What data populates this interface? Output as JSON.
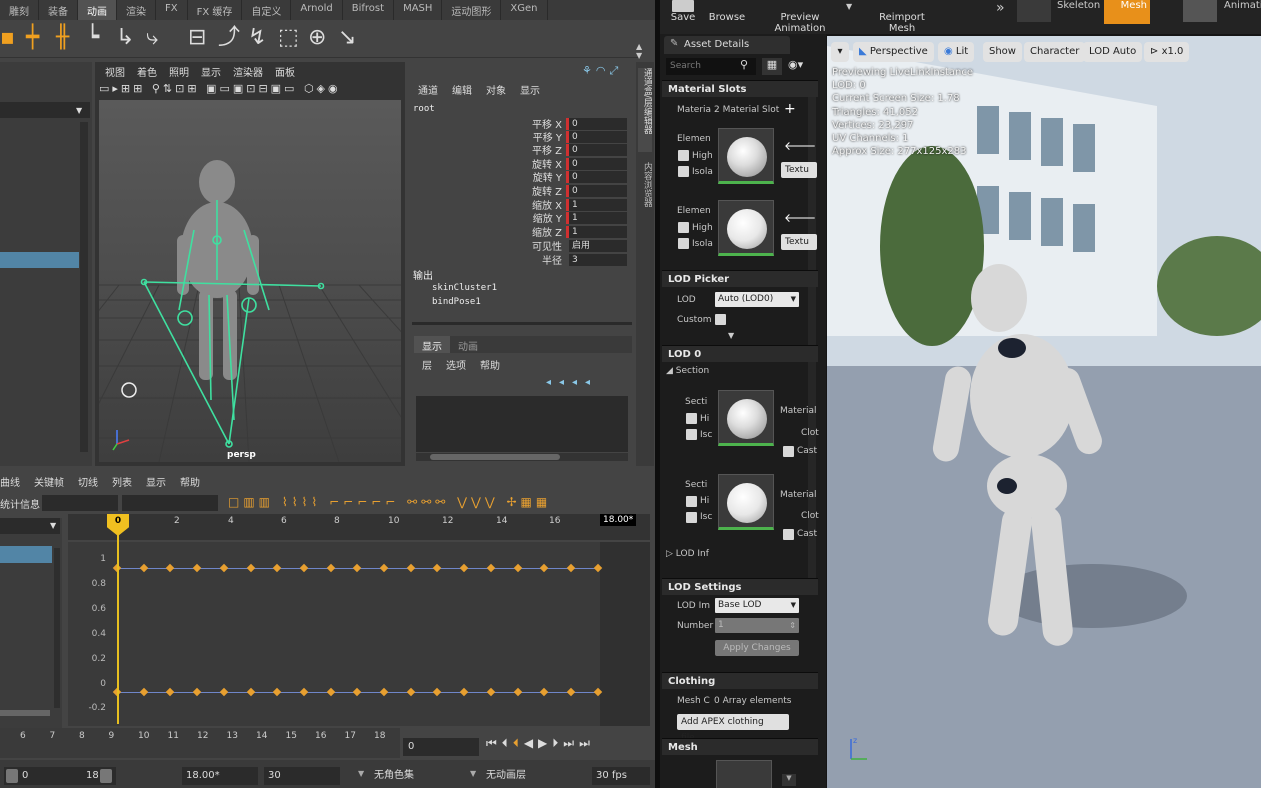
{
  "maya": {
    "shelf_tabs": [
      "雕刻",
      "装备",
      "动画",
      "渲染",
      "FX",
      "FX 缓存",
      "自定义",
      "Arnold",
      "Bifrost",
      "MASH",
      "运动图形",
      "XGen"
    ],
    "active_shelf_tab": "动画",
    "viewport_menu": [
      "视图",
      "着色",
      "照明",
      "显示",
      "渲染器",
      "面板"
    ],
    "viewport_label": "persp",
    "channel_menu": [
      "通道",
      "编辑",
      "对象",
      "显示"
    ],
    "node_name": "root",
    "attributes": [
      {
        "label": "平移 X",
        "value": "0"
      },
      {
        "label": "平移 Y",
        "value": "0"
      },
      {
        "label": "平移 Z",
        "value": "0"
      },
      {
        "label": "旋转 X",
        "value": "0"
      },
      {
        "label": "旋转 Y",
        "value": "0"
      },
      {
        "label": "旋转 Z",
        "value": "0"
      },
      {
        "label": "缩放 X",
        "value": "1"
      },
      {
        "label": "缩放 Y",
        "value": "1"
      },
      {
        "label": "缩放 Z",
        "value": "1"
      },
      {
        "label": "可见性",
        "value": "启用"
      },
      {
        "label": "半径",
        "value": "3"
      }
    ],
    "outputs_title": "输出",
    "outputs": [
      "skinCluster1",
      "bindPose1"
    ],
    "layer_tabs": [
      "显示",
      "动画"
    ],
    "layer_menu": [
      "层",
      "选项",
      "帮助"
    ],
    "side_tabs": [
      "通道盒/层编辑器",
      "内容浏览器"
    ],
    "graph_menu": [
      "曲线",
      "关键帧",
      "切线",
      "列表",
      "显示",
      "帮助"
    ],
    "stats_label": "统计信息",
    "graph_ruler": [
      "0",
      "2",
      "4",
      "6",
      "8",
      "10",
      "12",
      "14",
      "16",
      "18.00*"
    ],
    "y_ticks": [
      "1",
      "0.8",
      "0.6",
      "0.4",
      "0.2",
      "0",
      "-0.2"
    ],
    "timeline_numbers": [
      "6",
      "7",
      "8",
      "9",
      "10",
      "11",
      "12",
      "13",
      "14",
      "15",
      "16",
      "17",
      "18"
    ],
    "current_frame": "0",
    "range_start": "0",
    "range_end": "18",
    "range_end_value": "18.00*",
    "fps_field": "30",
    "character_set": "无角色集",
    "anim_layer": "无动画层",
    "fps": "30 fps"
  },
  "ue": {
    "toolbar": [
      {
        "label": "Save",
        "icon": "save-icon"
      },
      {
        "label": "Browse",
        "icon": "browse-icon"
      },
      {
        "label": "Preview Animation",
        "icon": "preview-animation-icon"
      },
      {
        "label": "Reimport Mesh",
        "icon": "reimport-icon"
      }
    ],
    "mode_tabs": [
      "Skeleton",
      "Mesh",
      "Animation"
    ],
    "active_mode": "Mesh",
    "panel_tab": "Asset Details",
    "search_placeholder": "Search",
    "material_slots": {
      "header": "Material Slots",
      "label": "Materia",
      "count": "2 Material Slot",
      "elements": [
        {
          "label": "Elemen",
          "highlight": "High",
          "isolate": "Isola",
          "btn": "Textu"
        },
        {
          "label": "Elemen",
          "highlight": "High",
          "isolate": "Isola",
          "btn": "Textu"
        }
      ]
    },
    "lod_picker": {
      "header": "LOD Picker",
      "lod_label": "LOD",
      "lod_value": "Auto (LOD0)",
      "custom_label": "Custom"
    },
    "lod0": {
      "header": "LOD 0",
      "section_label": "Section",
      "sections": [
        {
          "label": "Secti",
          "hi": "Hi",
          "is": "Isc",
          "material": "Material",
          "clot": "Clot",
          "cast": "Cast"
        },
        {
          "label": "Secti",
          "hi": "Hi",
          "is": "Isc",
          "material": "Material",
          "clot": "Clot",
          "cast": "Cast"
        }
      ],
      "lod_info": "LOD Inf"
    },
    "lod_settings": {
      "header": "LOD Settings",
      "lod_import_label": "LOD Im",
      "lod_import_value": "Base LOD",
      "number_label": "Number",
      "number_value": "1",
      "apply": "Apply Changes"
    },
    "clothing": {
      "header": "Clothing",
      "mesh_label": "Mesh C",
      "mesh_value": "0 Array elements",
      "add_btn": "Add APEX clothing file..."
    },
    "mesh": {
      "header": "Mesh"
    },
    "viewport": {
      "buttons": [
        "Perspective",
        "Lit",
        "Show",
        "Character",
        "LOD Auto",
        "x1.0"
      ],
      "info": [
        "Previewing LiveLinkInstance",
        "LOD: 0",
        "Current Screen Size: 1.78",
        "Triangles: 41,052",
        "Vertices: 23,297",
        "UV Channels: 1",
        "Approx Size: 277x125x283"
      ]
    }
  }
}
